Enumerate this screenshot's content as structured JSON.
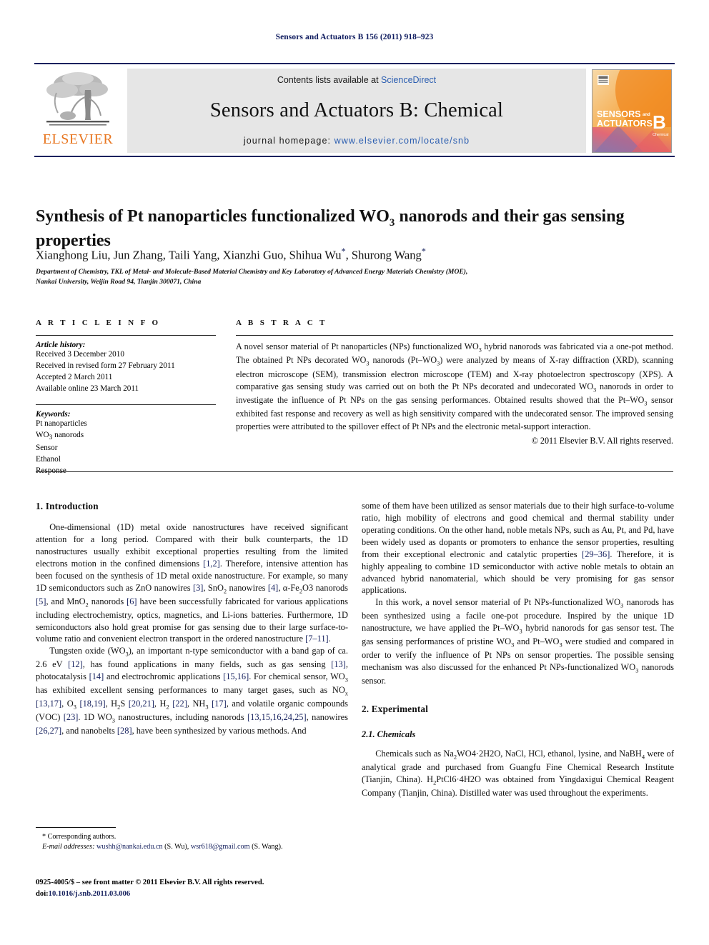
{
  "running_head": "Sensors and Actuators B 156 (2011) 918–923",
  "masthead": {
    "publisher_name": "ELSEVIER",
    "contents_prefix": "Contents lists available at ",
    "contents_link": "ScienceDirect",
    "journal_title": "Sensors and Actuators B: Chemical",
    "homepage_prefix": "journal homepage:",
    "homepage_url": "www.elsevier.com/locate/snb",
    "cover": {
      "line1": "SENSORS",
      "line2": "ACTUATORS",
      "and": "and",
      "letter": "B",
      "subtitle": "Chemical"
    }
  },
  "article": {
    "title_part1": "Synthesis of Pt nanoparticles functionalized WO",
    "title_sub": "3",
    "title_part2": " nanorods and their gas sensing properties",
    "authors": "Xianghong Liu, Jun Zhang, Taili Yang, Xianzhi Guo, Shihua Wu",
    "authors_tail": ", Shurong Wang",
    "affiliation_line1": "Department of Chemistry, TKL of Metal- and Molecule-Based Material Chemistry and Key Laboratory of Advanced Energy Materials Chemistry (MOE),",
    "affiliation_line2": "Nankai University, Weijin Road 94, Tianjin 300071, China"
  },
  "article_info": {
    "heading": "A R T I C L E   I N F O",
    "history_label": "Article history:",
    "history": [
      "Received 3 December 2010",
      "Received in revised form 27 February 2011",
      "Accepted 2 March 2011",
      "Available online 23 March 2011"
    ],
    "keywords_label": "Keywords:",
    "keywords": [
      "Pt nanoparticles",
      "WO3 nanorods",
      "Sensor",
      "Ethanol",
      "Response"
    ]
  },
  "abstract": {
    "heading": "A B S T R A C T",
    "text": "A novel sensor material of Pt nanoparticles (NPs) functionalized WO3 hybrid nanorods was fabricated via a one-pot method. The obtained Pt NPs decorated WO3 nanorods (Pt–WO3) were analyzed by means of X-ray diffraction (XRD), scanning electron microscope (SEM), transmission electron microscope (TEM) and X-ray photoelectron spectroscopy (XPS). A comparative gas sensing study was carried out on both the Pt NPs decorated and undecorated WO3 nanorods in order to investigate the influence of Pt NPs on the gas sensing performances. Obtained results showed that the Pt–WO3 sensor exhibited fast response and recovery as well as high sensitivity compared with the undecorated sensor. The improved sensing properties were attributed to the spillover effect of Pt NPs and the electronic metal-support interaction.",
    "copyright": "© 2011 Elsevier B.V. All rights reserved."
  },
  "body": {
    "section1_heading": "1.  Introduction",
    "intro_p1": "One-dimensional (1D) metal oxide nanostructures have received significant attention for a long period. Compared with their bulk counterparts, the 1D nanostructures usually exhibit exceptional properties resulting from the limited electrons motion in the confined dimensions [1,2]. Therefore, intensive attention has been focused on the synthesis of 1D metal oxide nanostructure. For example, so many 1D semiconductors such as ZnO nanowires [3], SnO2 nanowires [4], α-Fe2O3 nanorods [5], and MnO2 nanorods [6] have been successfully fabricated for various applications including electrochemistry, optics, magnetics, and Li-ions batteries. Furthermore, 1D semiconductors also hold great promise for gas sensing due to their large surface-to-volume ratio and convenient electron transport in the ordered nanostructure [7–11].",
    "intro_p2": "Tungsten oxide (WO3), an important n-type semiconductor with a band gap of ca. 2.6 eV [12], has found applications in many fields, such as gas sensing [13], photocatalysis [14] and electrochromic applications [15,16]. For chemical sensor, WO3 has exhibited excellent sensing performances to many target gases, such as NOx [13,17], O3 [18,19], H2S [20,21], H2 [22], NH3 [17], and volatile organic compounds (VOC) [23]. 1D WO3 nanostructures, including nanorods [13,15,16,24,25], nanowires [26,27], and nanobelts [28], have been synthesized by various methods. And",
    "intro_p3": "some of them have been utilized as sensor materials due to their high surface-to-volume ratio, high mobility of electrons and good chemical and thermal stability under operating conditions. On the other hand, noble metals NPs, such as Au, Pt, and Pd, have been widely used as dopants or promoters to enhance the sensor properties, resulting from their exceptional electronic and catalytic properties [29–36]. Therefore, it is highly appealing to combine 1D semiconductor with active noble metals to obtain an advanced hybrid nanomaterial, which should be very promising for gas sensor applications.",
    "intro_p4": "In this work, a novel sensor material of Pt NPs-functionalized WO3 nanorods has been synthesized using a facile one-pot procedure. Inspired by the unique 1D nanostructure, we have applied the Pt–WO3 hybrid nanorods for gas sensor test. The gas sensing performances of pristine WO3 and Pt–WO3 were studied and compared in order to verify the influence of Pt NPs on sensor properties. The possible sensing mechanism was also discussed for the enhanced Pt NPs-functionalized WO3 nanorods sensor.",
    "section2_heading": "2.  Experimental",
    "section21_heading": "2.1.  Chemicals",
    "chemicals_p1": "Chemicals such as Na2WO4·2H2O, NaCl, HCl, ethanol, lysine, and NaBH4 were of analytical grade and purchased from Guangfu Fine Chemical Research Institute (Tianjin, China). H2PtCl6·4H2O was obtained from Yingdaxigui Chemical Reagent Company (Tianjin, China). Distilled water was used throughout the experiments."
  },
  "footnotes": {
    "corresponding": "* Corresponding authors.",
    "email_label": "E-mail addresses:",
    "email1": "wushh@nankai.edu.cn",
    "email1_owner": "(S. Wu),",
    "email2": "wsr618@gmail.com",
    "email2_owner": "(S. Wang)."
  },
  "issn": {
    "line1": "0925-4005/$ – see front matter © 2011 Elsevier B.V. All rights reserved.",
    "doi_label": "doi:",
    "doi_value": "10.1016/j.snb.2011.03.006"
  },
  "colors": {
    "navy": "#16215e",
    "link_blue": "#2a5db0",
    "elsevier_orange": "#e87722",
    "band_gray": "#e6e6e6"
  }
}
